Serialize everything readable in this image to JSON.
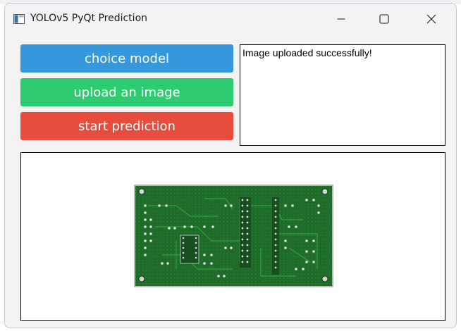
{
  "window": {
    "title": "YOLOv5 PyQt Prediction",
    "icon": "app-window-icon",
    "controls": {
      "minimize_icon": "minimize-icon",
      "maximize_icon": "maximize-icon",
      "close_icon": "close-icon"
    }
  },
  "buttons": {
    "choice_model": "choice model",
    "upload_image": "upload an image",
    "start_prediction": "start prediction"
  },
  "log": {
    "message": "Image uploaded successfully!"
  },
  "image_panel": {
    "content": "pcb-board-image"
  },
  "colors": {
    "choice_model": "#3598dc",
    "upload_image": "#2ecc71",
    "start_prediction": "#e74c3c",
    "window_background": "#f3f3f3",
    "pcb_green": "#1f6b2a"
  }
}
